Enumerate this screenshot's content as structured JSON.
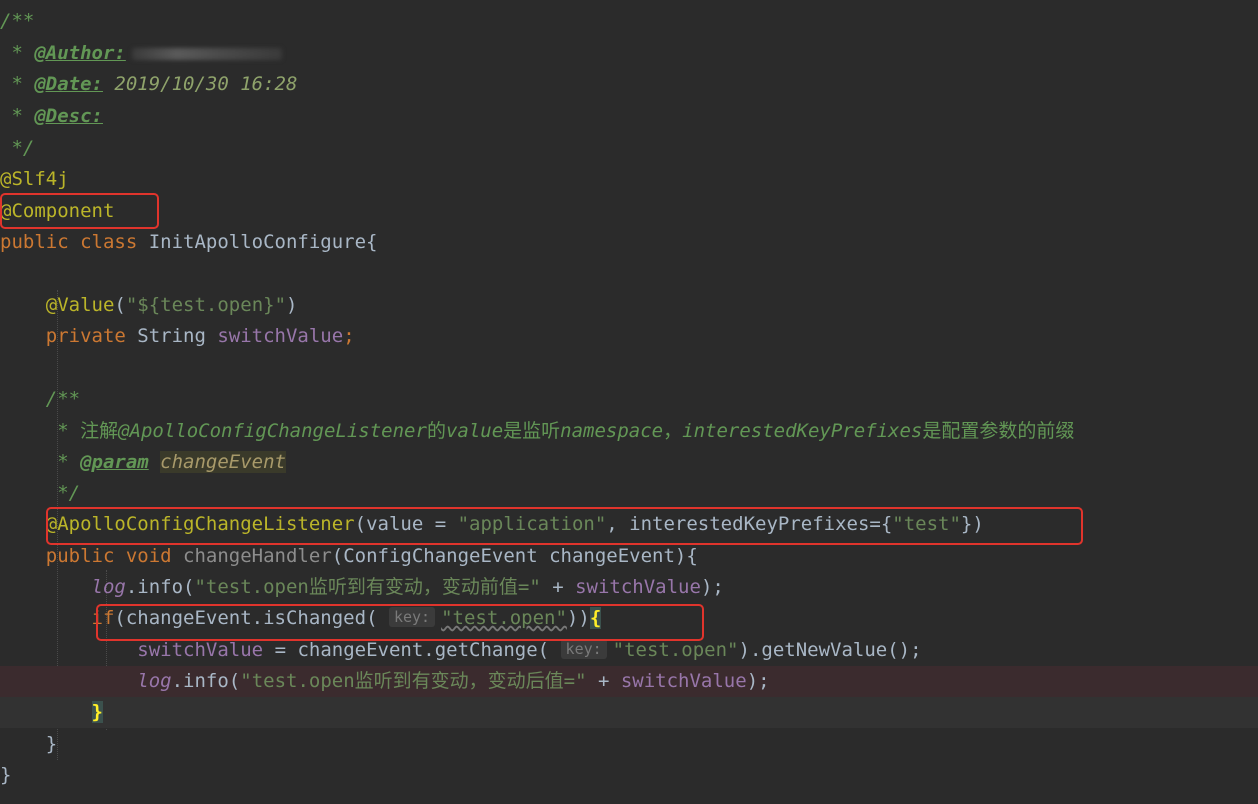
{
  "code": {
    "l1": [
      "/**"
    ],
    "l2": [
      " * ",
      "@Author:"
    ],
    "l3": [
      " * ",
      "@Date:",
      " 2019/10/30 16:28"
    ],
    "l4": [
      " * ",
      "@Desc:"
    ],
    "l5": [
      " */"
    ],
    "l6": [
      "@Slf4j"
    ],
    "l7": [
      "@Component"
    ],
    "l8": [
      "public class ",
      "InitApolloConfigure{"
    ],
    "l10": [
      "    ",
      "@Value",
      "(",
      "\"${test.open}\"",
      ")"
    ],
    "l11": [
      "    ",
      "private ",
      "String ",
      "switchValue",
      ";"
    ],
    "l13": [
      "    /**"
    ],
    "l14": [
      "     * 注解",
      "@ApolloConfigChangeListener",
      "的",
      "value",
      "是监听",
      "namespace",
      "，",
      "interestedKeyPrefixes",
      "是配置参数的前缀"
    ],
    "l15": [
      "     * ",
      "@param",
      " ",
      "changeEvent"
    ],
    "l16": [
      "     */"
    ],
    "l17": [
      "    ",
      "@ApolloConfigChangeListener",
      "(value = ",
      "\"application\"",
      ", interestedKeyPrefixes={",
      "\"test\"",
      "})"
    ],
    "l18": [
      "    ",
      "public void ",
      "changeHandler",
      "(ConfigChangeEvent changeEvent){"
    ],
    "l19": [
      "        ",
      "log",
      ".info(",
      "\"test.open监听到有变动，变动前值=\"",
      " + ",
      "switchValue",
      ");"
    ],
    "l20": [
      "        ",
      "if",
      "(changeEvent.isChanged( ",
      "key:",
      "\"test.open\"",
      "))",
      "{"
    ],
    "l21": [
      "            ",
      "switchValue",
      " = changeEvent.getChange( ",
      "key:",
      "\"test.open\"",
      ").getNewValue();"
    ],
    "l22": [
      "            ",
      "log",
      ".info(",
      "\"test.open监听到有变动，变动后值=\"",
      " + ",
      "switchValue",
      ");"
    ],
    "l23": [
      "        ",
      "}"
    ],
    "l24": [
      "    }"
    ],
    "l25": [
      "}"
    ]
  },
  "colors": {
    "background": "#2b2b2b",
    "keyword": "#cc7832",
    "string": "#6a8759",
    "annotation": "#bbb529",
    "field": "#9876aa",
    "doc_comment": "#629755",
    "highlight_box": "#e0342c"
  }
}
